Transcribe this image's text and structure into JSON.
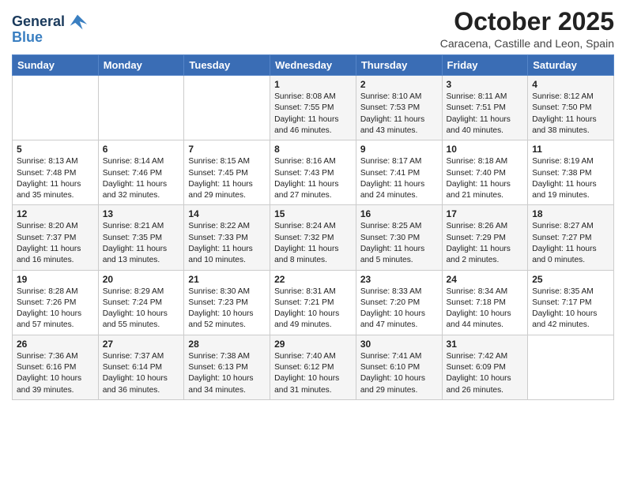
{
  "logo": {
    "line1": "General",
    "line2": "Blue"
  },
  "header": {
    "month": "October 2025",
    "location": "Caracena, Castille and Leon, Spain"
  },
  "days_of_week": [
    "Sunday",
    "Monday",
    "Tuesday",
    "Wednesday",
    "Thursday",
    "Friday",
    "Saturday"
  ],
  "weeks": [
    [
      {
        "day": "",
        "content": ""
      },
      {
        "day": "",
        "content": ""
      },
      {
        "day": "",
        "content": ""
      },
      {
        "day": "1",
        "content": "Sunrise: 8:08 AM\nSunset: 7:55 PM\nDaylight: 11 hours\nand 46 minutes."
      },
      {
        "day": "2",
        "content": "Sunrise: 8:10 AM\nSunset: 7:53 PM\nDaylight: 11 hours\nand 43 minutes."
      },
      {
        "day": "3",
        "content": "Sunrise: 8:11 AM\nSunset: 7:51 PM\nDaylight: 11 hours\nand 40 minutes."
      },
      {
        "day": "4",
        "content": "Sunrise: 8:12 AM\nSunset: 7:50 PM\nDaylight: 11 hours\nand 38 minutes."
      }
    ],
    [
      {
        "day": "5",
        "content": "Sunrise: 8:13 AM\nSunset: 7:48 PM\nDaylight: 11 hours\nand 35 minutes."
      },
      {
        "day": "6",
        "content": "Sunrise: 8:14 AM\nSunset: 7:46 PM\nDaylight: 11 hours\nand 32 minutes."
      },
      {
        "day": "7",
        "content": "Sunrise: 8:15 AM\nSunset: 7:45 PM\nDaylight: 11 hours\nand 29 minutes."
      },
      {
        "day": "8",
        "content": "Sunrise: 8:16 AM\nSunset: 7:43 PM\nDaylight: 11 hours\nand 27 minutes."
      },
      {
        "day": "9",
        "content": "Sunrise: 8:17 AM\nSunset: 7:41 PM\nDaylight: 11 hours\nand 24 minutes."
      },
      {
        "day": "10",
        "content": "Sunrise: 8:18 AM\nSunset: 7:40 PM\nDaylight: 11 hours\nand 21 minutes."
      },
      {
        "day": "11",
        "content": "Sunrise: 8:19 AM\nSunset: 7:38 PM\nDaylight: 11 hours\nand 19 minutes."
      }
    ],
    [
      {
        "day": "12",
        "content": "Sunrise: 8:20 AM\nSunset: 7:37 PM\nDaylight: 11 hours\nand 16 minutes."
      },
      {
        "day": "13",
        "content": "Sunrise: 8:21 AM\nSunset: 7:35 PM\nDaylight: 11 hours\nand 13 minutes."
      },
      {
        "day": "14",
        "content": "Sunrise: 8:22 AM\nSunset: 7:33 PM\nDaylight: 11 hours\nand 10 minutes."
      },
      {
        "day": "15",
        "content": "Sunrise: 8:24 AM\nSunset: 7:32 PM\nDaylight: 11 hours\nand 8 minutes."
      },
      {
        "day": "16",
        "content": "Sunrise: 8:25 AM\nSunset: 7:30 PM\nDaylight: 11 hours\nand 5 minutes."
      },
      {
        "day": "17",
        "content": "Sunrise: 8:26 AM\nSunset: 7:29 PM\nDaylight: 11 hours\nand 2 minutes."
      },
      {
        "day": "18",
        "content": "Sunrise: 8:27 AM\nSunset: 7:27 PM\nDaylight: 11 hours\nand 0 minutes."
      }
    ],
    [
      {
        "day": "19",
        "content": "Sunrise: 8:28 AM\nSunset: 7:26 PM\nDaylight: 10 hours\nand 57 minutes."
      },
      {
        "day": "20",
        "content": "Sunrise: 8:29 AM\nSunset: 7:24 PM\nDaylight: 10 hours\nand 55 minutes."
      },
      {
        "day": "21",
        "content": "Sunrise: 8:30 AM\nSunset: 7:23 PM\nDaylight: 10 hours\nand 52 minutes."
      },
      {
        "day": "22",
        "content": "Sunrise: 8:31 AM\nSunset: 7:21 PM\nDaylight: 10 hours\nand 49 minutes."
      },
      {
        "day": "23",
        "content": "Sunrise: 8:33 AM\nSunset: 7:20 PM\nDaylight: 10 hours\nand 47 minutes."
      },
      {
        "day": "24",
        "content": "Sunrise: 8:34 AM\nSunset: 7:18 PM\nDaylight: 10 hours\nand 44 minutes."
      },
      {
        "day": "25",
        "content": "Sunrise: 8:35 AM\nSunset: 7:17 PM\nDaylight: 10 hours\nand 42 minutes."
      }
    ],
    [
      {
        "day": "26",
        "content": "Sunrise: 7:36 AM\nSunset: 6:16 PM\nDaylight: 10 hours\nand 39 minutes."
      },
      {
        "day": "27",
        "content": "Sunrise: 7:37 AM\nSunset: 6:14 PM\nDaylight: 10 hours\nand 36 minutes."
      },
      {
        "day": "28",
        "content": "Sunrise: 7:38 AM\nSunset: 6:13 PM\nDaylight: 10 hours\nand 34 minutes."
      },
      {
        "day": "29",
        "content": "Sunrise: 7:40 AM\nSunset: 6:12 PM\nDaylight: 10 hours\nand 31 minutes."
      },
      {
        "day": "30",
        "content": "Sunrise: 7:41 AM\nSunset: 6:10 PM\nDaylight: 10 hours\nand 29 minutes."
      },
      {
        "day": "31",
        "content": "Sunrise: 7:42 AM\nSunset: 6:09 PM\nDaylight: 10 hours\nand 26 minutes."
      },
      {
        "day": "",
        "content": ""
      }
    ]
  ]
}
